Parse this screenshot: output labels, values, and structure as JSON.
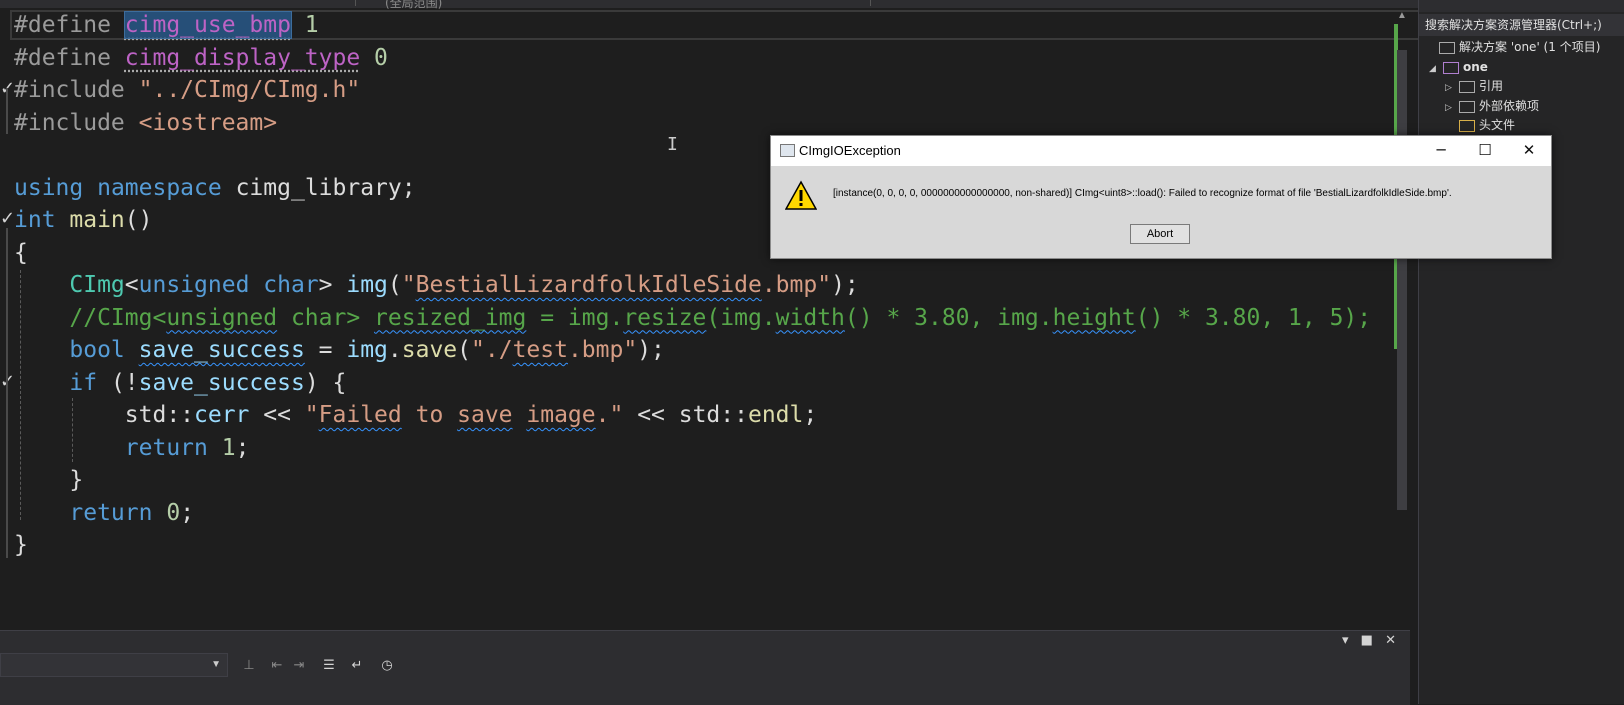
{
  "editor": {
    "tab_fragment": "(全局范围)",
    "lines": [
      {
        "segs": [
          {
            "t": "#define ",
            "c": "pp"
          },
          {
            "t": "cimg_use_bmp",
            "c": "mc sel dots"
          },
          {
            "t": " 1",
            "c": "nm"
          }
        ]
      },
      {
        "segs": [
          {
            "t": "#define ",
            "c": "pp"
          },
          {
            "t": "cimg_display_type",
            "c": "mc dots"
          },
          {
            "t": " 0",
            "c": "nm"
          }
        ]
      },
      {
        "segs": [
          {
            "t": "#include ",
            "c": "pp"
          },
          {
            "t": "\"../CImg/CImg.h\"",
            "c": "st"
          }
        ]
      },
      {
        "segs": [
          {
            "t": "#include ",
            "c": "pp"
          },
          {
            "t": "<iostream>",
            "c": "st"
          }
        ]
      },
      {
        "segs": []
      },
      {
        "segs": [
          {
            "t": "using ",
            "c": "kw"
          },
          {
            "t": "namespace ",
            "c": "kw"
          },
          {
            "t": "cimg_library",
            "c": ""
          },
          {
            "t": ";",
            "c": ""
          }
        ]
      },
      {
        "segs": [
          {
            "t": "int ",
            "c": "kw"
          },
          {
            "t": "main",
            "c": "fn"
          },
          {
            "t": "()",
            "c": ""
          }
        ]
      },
      {
        "segs": [
          {
            "t": "{",
            "c": ""
          }
        ]
      },
      {
        "segs": [
          {
            "t": "    ",
            "c": ""
          },
          {
            "t": "CImg",
            "c": "ty"
          },
          {
            "t": "<",
            "c": ""
          },
          {
            "t": "unsigned char",
            "c": "kw"
          },
          {
            "t": "> ",
            "c": ""
          },
          {
            "t": "img",
            "c": "vr"
          },
          {
            "t": "(",
            "c": ""
          },
          {
            "t": "\"",
            "c": "st"
          },
          {
            "t": "BestialLizardfolkIdleSide",
            "c": "st sq"
          },
          {
            "t": ".bmp\"",
            "c": "st"
          },
          {
            "t": ");",
            "c": ""
          }
        ]
      },
      {
        "segs": [
          {
            "t": "    //CImg<",
            "c": "cm"
          },
          {
            "t": "unsigned",
            "c": "cm sq"
          },
          {
            "t": " char> ",
            "c": "cm"
          },
          {
            "t": "resized_img",
            "c": "cm sq"
          },
          {
            "t": " = img.",
            "c": "cm"
          },
          {
            "t": "resize",
            "c": "cm sq"
          },
          {
            "t": "(img.",
            "c": "cm"
          },
          {
            "t": "width",
            "c": "cm sq"
          },
          {
            "t": "() * 3.80, img.",
            "c": "cm"
          },
          {
            "t": "height",
            "c": "cm sq"
          },
          {
            "t": "() * 3.80, 1, 5);",
            "c": "cm"
          }
        ]
      },
      {
        "segs": [
          {
            "t": "    ",
            "c": ""
          },
          {
            "t": "bool ",
            "c": "kw"
          },
          {
            "t": "save_success",
            "c": "vr sq"
          },
          {
            "t": " = ",
            "c": ""
          },
          {
            "t": "img",
            "c": "vr"
          },
          {
            "t": ".",
            "c": ""
          },
          {
            "t": "save",
            "c": "fn"
          },
          {
            "t": "(",
            "c": ""
          },
          {
            "t": "\"./",
            "c": "st"
          },
          {
            "t": "test",
            "c": "st sq"
          },
          {
            "t": ".bmp\"",
            "c": "st"
          },
          {
            "t": ");",
            "c": ""
          }
        ]
      },
      {
        "segs": [
          {
            "t": "    ",
            "c": ""
          },
          {
            "t": "if",
            "c": "kw"
          },
          {
            "t": " (!",
            "c": ""
          },
          {
            "t": "save_success",
            "c": "vr"
          },
          {
            "t": ") {",
            "c": ""
          }
        ]
      },
      {
        "segs": [
          {
            "t": "        std::",
            "c": ""
          },
          {
            "t": "cerr",
            "c": "vr"
          },
          {
            "t": " << ",
            "c": ""
          },
          {
            "t": "\"",
            "c": "st"
          },
          {
            "t": "Failed",
            "c": "st sq"
          },
          {
            "t": " to ",
            "c": "st"
          },
          {
            "t": "save",
            "c": "st sq"
          },
          {
            "t": " ",
            "c": "st"
          },
          {
            "t": "image",
            "c": "st sq"
          },
          {
            "t": ".\"",
            "c": "st"
          },
          {
            "t": " << std::",
            "c": ""
          },
          {
            "t": "endl",
            "c": "fn"
          },
          {
            "t": ";",
            "c": ""
          }
        ]
      },
      {
        "segs": [
          {
            "t": "        ",
            "c": ""
          },
          {
            "t": "return ",
            "c": "kw"
          },
          {
            "t": "1",
            "c": "nm"
          },
          {
            "t": ";",
            "c": ""
          }
        ]
      },
      {
        "segs": [
          {
            "t": "    }",
            "c": ""
          }
        ]
      },
      {
        "segs": [
          {
            "t": "    ",
            "c": ""
          },
          {
            "t": "return ",
            "c": "kw"
          },
          {
            "t": "0",
            "c": "nm"
          },
          {
            "t": ";",
            "c": ""
          }
        ]
      },
      {
        "segs": [
          {
            "t": "}",
            "c": ""
          }
        ]
      }
    ]
  },
  "solution": {
    "search": "搜索解决方案资源管理器(Ctrl+;)",
    "items": [
      {
        "label": "解决方案 'one' (1 个项目)",
        "bold": false,
        "tw": ""
      },
      {
        "label": "one",
        "bold": true,
        "tw": "◢"
      },
      {
        "label": "引用",
        "bold": false,
        "tw": "▷"
      },
      {
        "label": "外部依赖项",
        "bold": false,
        "tw": "▷"
      },
      {
        "label": "头文件",
        "bold": false,
        "tw": ""
      }
    ]
  },
  "dialog": {
    "title": "CImgIOException",
    "message": "[instance(0, 0, 0, 0, 0000000000000000, non-shared)] CImg<uint8>::load(): Failed to recognize format of file 'BestialLizardfolkIdleSide.bmp'.",
    "abort_label": "Abort",
    "minimize": "─",
    "maximize": "☐",
    "close": "✕"
  },
  "bottom": {
    "panel_dropdown": "▾",
    "maximize": "■",
    "close": "✕",
    "tool_icons": [
      "align-icon",
      "indent-left-icon",
      "indent-right-icon",
      "list-icon",
      "wrap-icon",
      "clock-icon"
    ]
  },
  "colors": {
    "editor_bg": "#1e1e1e",
    "keyword": "#569cd6",
    "type": "#4ec9b0",
    "string": "#d69d85",
    "comment": "#57a64a",
    "macro": "#bd63c5",
    "dialog_bg": "#d8d8d8"
  }
}
